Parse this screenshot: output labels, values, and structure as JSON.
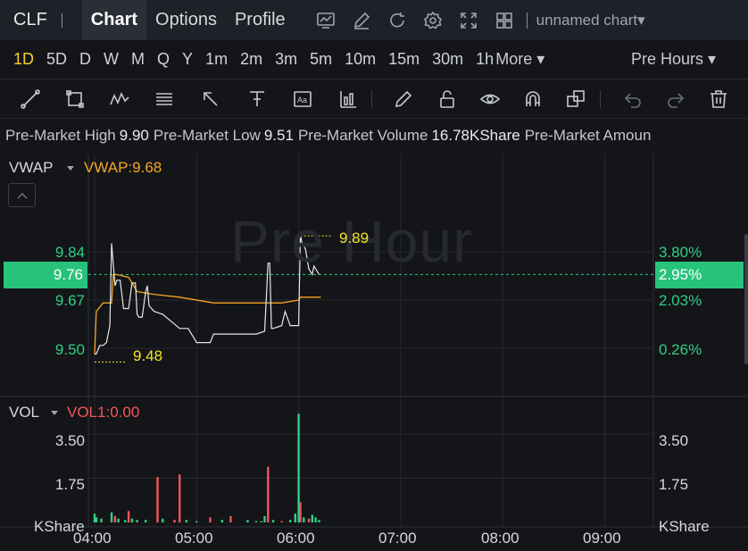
{
  "header": {
    "symbol": "CLF",
    "tabs": [
      "Chart",
      "Options",
      "Profile"
    ],
    "active_tab": "Chart",
    "icons": [
      "chart-settings-icon",
      "edit-icon",
      "refresh-icon",
      "gear-icon",
      "fullscreen-icon",
      "grid-layout-icon"
    ],
    "chart_name": "unnamed chart▾"
  },
  "periods": {
    "items": [
      "1D",
      "5D",
      "D",
      "W",
      "M",
      "Q",
      "Y",
      "1m",
      "2m",
      "3m",
      "5m",
      "10m",
      "15m",
      "30m",
      "1h"
    ],
    "active": "1D",
    "more_label": "More ▾",
    "session_label": "Pre Hours ▾"
  },
  "drawing_tools": [
    "trendline-icon",
    "rectangle-icon",
    "pattern-icon",
    "fib-icon",
    "arrow-icon",
    "measure-icon",
    "text-icon",
    "volume-profile-icon",
    "pencil-icon",
    "lock-icon",
    "eye-icon",
    "magnet-icon",
    "layers-icon",
    "undo-icon",
    "redo-icon",
    "trash-icon"
  ],
  "stats": {
    "items": [
      {
        "label": "Pre-Market High",
        "value": "9.90"
      },
      {
        "label": "Pre-Market Low",
        "value": "9.51"
      },
      {
        "label": "Pre-Market Volume",
        "value": "16.78KShare"
      },
      {
        "label": "Pre-Market Amoun",
        "value": ""
      }
    ]
  },
  "price_panel": {
    "indicator": "VWAP",
    "indicator_value": "VWAP:9.68",
    "watermark": "Pre Hour",
    "current_price": "9.76",
    "current_pct": "2.95%",
    "left_ticks": [
      "9.84",
      "9.67",
      "9.50"
    ],
    "right_ticks": [
      "3.80%",
      "2.03%",
      "0.26%"
    ],
    "high_label": "9.89",
    "low_label": "9.48"
  },
  "volume_panel": {
    "indicator": "VOL",
    "indicator_value": "VOL1:0.00",
    "ticks": [
      "3.50",
      "1.75"
    ],
    "unit": "KShare"
  },
  "colors": {
    "up": "#2ecf84",
    "down": "#f2565b",
    "vwap": "#f5a623",
    "price": "#e8e8e8",
    "annotation": "#f6e326",
    "active": "#f7cf2a"
  },
  "chart_data": [
    {
      "type": "line",
      "title": "",
      "x_ticks": [
        "04:00",
        "05:00",
        "06:00",
        "07:00",
        "08:00",
        "09:00"
      ],
      "x_range": [
        "04:00",
        "09:30"
      ],
      "ylim": [
        9.44,
        9.97
      ],
      "y_ticks": [
        9.5,
        9.67,
        9.84
      ],
      "current_price": 9.76,
      "annotations": [
        {
          "text": "9.89",
          "value": 9.89
        },
        {
          "text": "9.48",
          "value": 9.48
        }
      ],
      "series": [
        {
          "name": "VWAP",
          "x": [
            "04:00",
            "04:01",
            "04:05",
            "04:10",
            "04:11",
            "04:13",
            "04:20",
            "04:25",
            "04:35",
            "04:50",
            "05:10",
            "05:30",
            "05:50",
            "06:00",
            "06:01",
            "06:05",
            "06:13"
          ],
          "values": [
            9.48,
            9.63,
            9.66,
            9.66,
            9.76,
            9.76,
            9.75,
            9.7,
            9.69,
            9.68,
            9.66,
            9.66,
            9.66,
            9.67,
            9.68,
            9.68,
            9.68
          ]
        },
        {
          "x": [
            "04:00",
            "04:01",
            "04:03",
            "04:05",
            "04:07",
            "04:09",
            "04:10",
            "04:12",
            "04:13",
            "04:15",
            "04:17",
            "04:20",
            "04:22",
            "04:24",
            "04:25",
            "04:26",
            "04:28",
            "04:30",
            "04:31",
            "04:32",
            "04:35",
            "04:40",
            "04:50",
            "04:55",
            "05:00",
            "05:08",
            "05:10",
            "05:20",
            "05:35",
            "05:40",
            "05:42",
            "05:43",
            "05:44",
            "05:45",
            "05:50",
            "05:52",
            "05:55",
            "05:59",
            "06:00",
            "06:01",
            "06:02",
            "06:04",
            "06:06",
            "06:08",
            "06:09",
            "06:10",
            "06:12"
          ],
          "values": [
            9.48,
            9.48,
            9.51,
            9.51,
            9.52,
            9.58,
            9.87,
            9.72,
            9.74,
            9.74,
            9.64,
            9.64,
            9.73,
            9.73,
            9.62,
            9.61,
            9.61,
            9.7,
            9.72,
            9.65,
            9.63,
            9.62,
            9.57,
            9.57,
            9.52,
            9.52,
            9.55,
            9.55,
            9.55,
            9.56,
            9.8,
            9.8,
            9.57,
            9.57,
            9.58,
            9.63,
            9.58,
            9.58,
            9.58,
            9.9,
            9.87,
            9.85,
            9.78,
            9.76,
            9.79,
            9.78,
            9.76
          ]
        }
      ]
    },
    {
      "type": "bar",
      "title": "",
      "ylabel": "KShare",
      "ylim": [
        0,
        4.5
      ],
      "y_ticks": [
        1.75,
        3.5
      ],
      "series": [
        {
          "x": [
            "04:00",
            "04:01",
            "04:04",
            "04:10",
            "04:12",
            "04:14",
            "04:18",
            "04:20",
            "04:22",
            "04:25",
            "04:30",
            "04:37",
            "04:40",
            "04:47",
            "04:50",
            "04:54",
            "05:00",
            "05:08",
            "05:15",
            "05:20",
            "05:30",
            "05:35",
            "05:38",
            "05:40",
            "05:42",
            "05:45",
            "05:50",
            "05:55",
            "05:58",
            "06:00",
            "06:01",
            "06:03",
            "06:06",
            "06:08",
            "06:10",
            "06:12"
          ],
          "values": [
            0.35,
            0.2,
            0.15,
            0.4,
            0.25,
            0.15,
            0.1,
            0.45,
            0.15,
            0.1,
            0.1,
            1.8,
            0.15,
            0.1,
            1.9,
            0.1,
            0.05,
            0.2,
            0.1,
            0.25,
            0.1,
            0.05,
            0.05,
            0.25,
            2.2,
            0.1,
            0.05,
            0.1,
            0.35,
            4.3,
            0.8,
            0.2,
            0.15,
            0.3,
            0.2,
            0.1
          ],
          "direction": [
            "up",
            "up",
            "up",
            "up",
            "down",
            "up",
            "up",
            "down",
            "up",
            "up",
            "up",
            "down",
            "up",
            "down",
            "down",
            "up",
            "up",
            "down",
            "up",
            "down",
            "up",
            "up",
            "up",
            "up",
            "down",
            "up",
            "down",
            "up",
            "up",
            "up",
            "down",
            "up",
            "down",
            "up",
            "up",
            "up"
          ]
        }
      ]
    }
  ]
}
